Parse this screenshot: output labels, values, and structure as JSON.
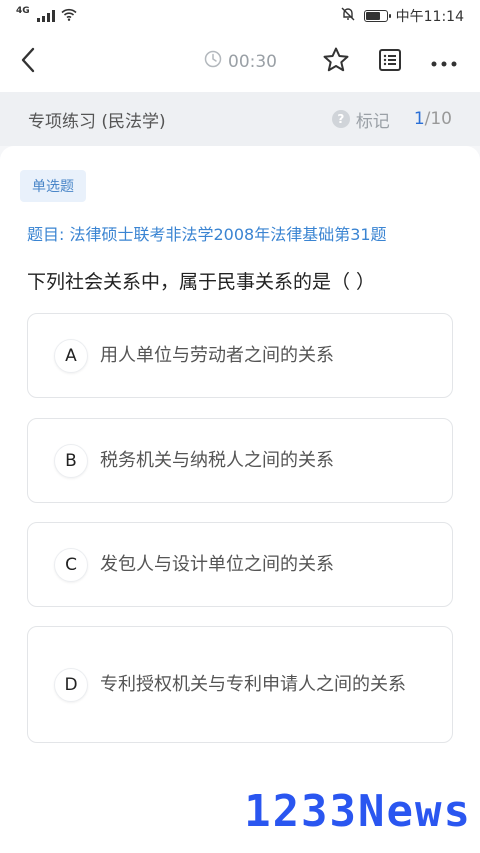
{
  "status_bar": {
    "network": "4G",
    "time": "中午11:14"
  },
  "nav": {
    "timer": "00:30",
    "icons": [
      "back-icon",
      "clock-icon",
      "star-icon",
      "answer-sheet-icon",
      "more-icon"
    ]
  },
  "section": {
    "title": "专项练习 (民法学)",
    "mark_label": "标记",
    "progress_current": "1",
    "progress_total": "/10"
  },
  "question": {
    "type": "单选题",
    "source": "题目: 法律硕士联考非法学2008年法律基础第31题",
    "stem": "下列社会关系中，属于民事关系的是（   ）",
    "options": [
      {
        "letter": "A",
        "text": "用人单位与劳动者之间的关系"
      },
      {
        "letter": "B",
        "text": "税务机关与纳税人之间的关系"
      },
      {
        "letter": "C",
        "text": "发包人与设计单位之间的关系"
      },
      {
        "letter": "D",
        "text": "专利授权机关与专利申请人之间的关系"
      }
    ]
  },
  "watermark": "1233News",
  "colors": {
    "accent": "#2b6fd6",
    "source_link": "#3a84d2",
    "tag_bg": "#e9f1fb"
  }
}
